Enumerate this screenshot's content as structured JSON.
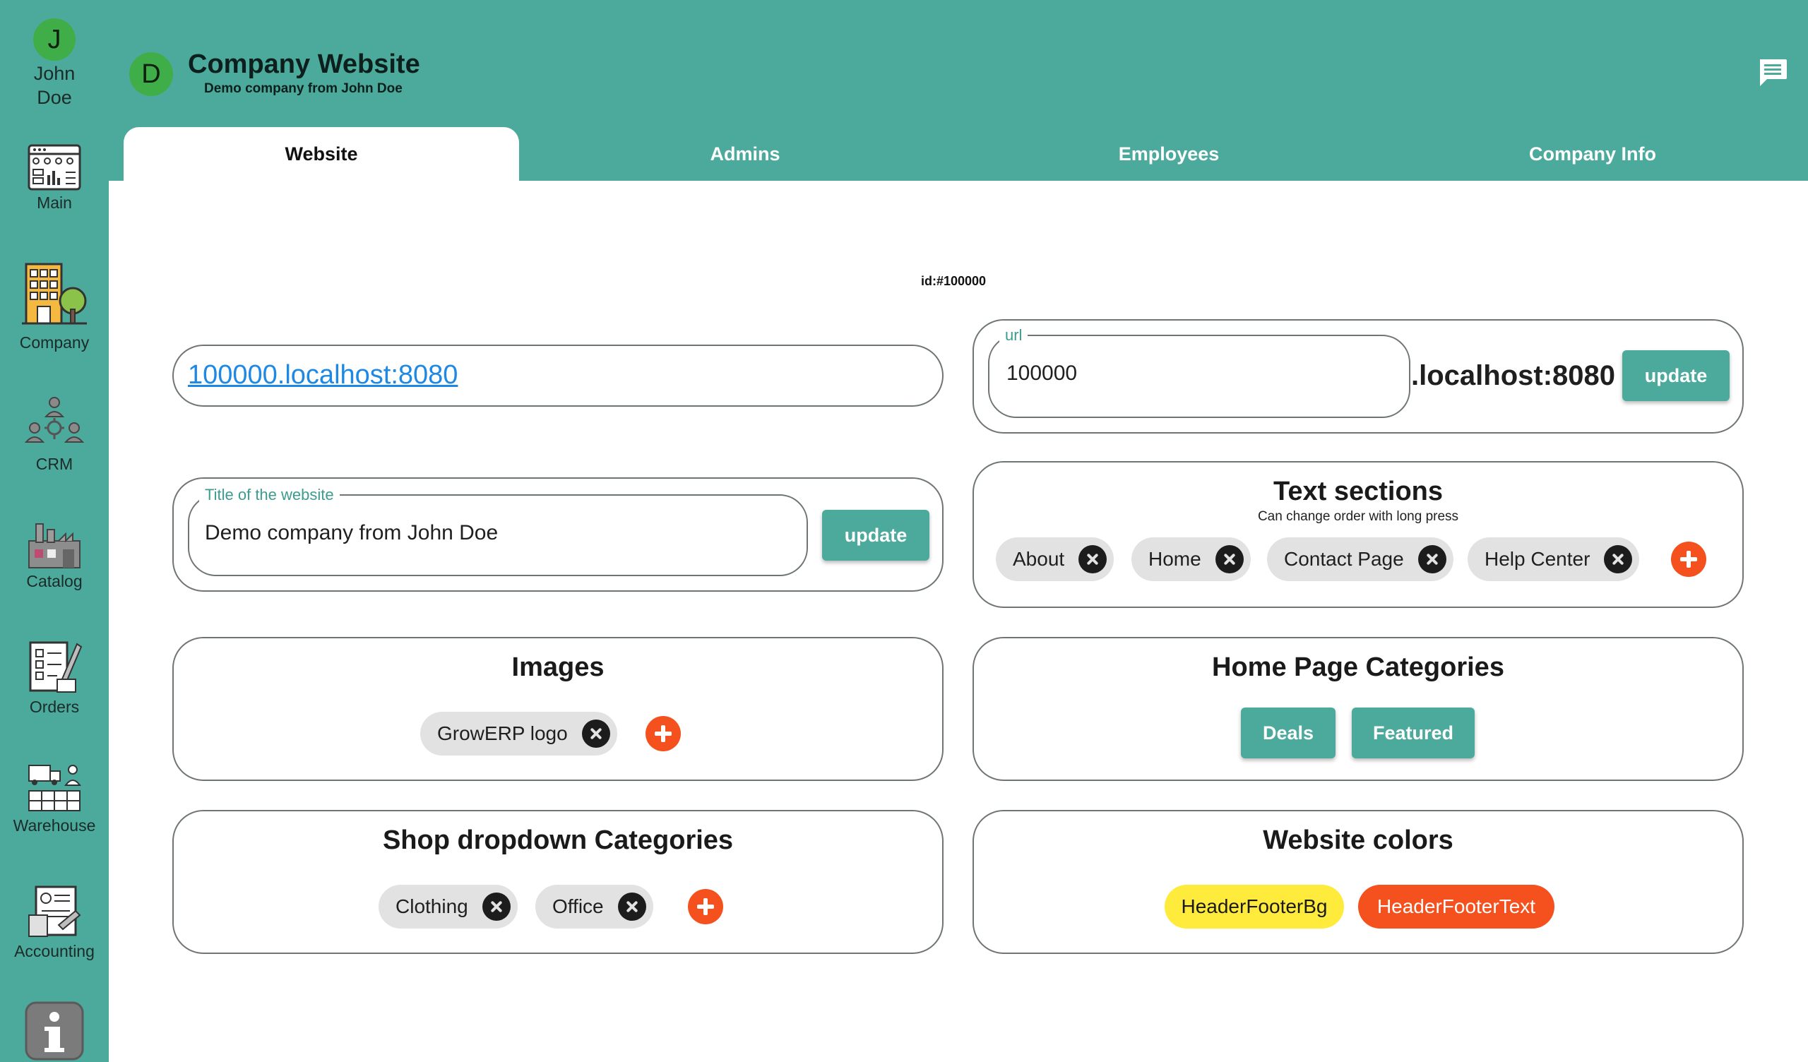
{
  "user": {
    "initial": "J",
    "first_name": "John",
    "last_name": "Doe"
  },
  "nav": [
    {
      "label": "Main",
      "icon": "dashboard-icon"
    },
    {
      "label": "Company",
      "icon": "building-icon"
    },
    {
      "label": "CRM",
      "icon": "people-network-icon"
    },
    {
      "label": "Catalog",
      "icon": "factory-icon"
    },
    {
      "label": "Orders",
      "icon": "order-form-icon"
    },
    {
      "label": "Accounting",
      "icon": "invoice-icon"
    },
    {
      "label": "Warehouse",
      "icon": "warehouse-truck-icon"
    },
    {
      "label": "",
      "icon": "info-icon"
    }
  ],
  "header": {
    "avatar_initial": "D",
    "title": "Company Website",
    "subtitle": "Demo company from John Doe",
    "chat_icon": "chat-icon"
  },
  "tabs": [
    "Website",
    "Admins",
    "Employees",
    "Company Info"
  ],
  "active_tab": "Website",
  "website": {
    "id_text": "id:#100000",
    "link": "100000.localhost:8080",
    "url_label": "url",
    "url_value": "100000",
    "url_suffix": ".localhost:8080",
    "url_update": "update",
    "title_label": "Title of the website",
    "title_value": "Demo company from John Doe",
    "title_update": "update"
  },
  "text_sections": {
    "title": "Text sections",
    "subtitle": "Can change order with long press",
    "items": [
      "About",
      "Home",
      "Contact Page",
      "Help Center"
    ]
  },
  "images": {
    "title": "Images",
    "items": [
      "GrowERP logo"
    ]
  },
  "home_categories": {
    "title": "Home Page Categories",
    "items": [
      "Deals",
      "Featured"
    ]
  },
  "shop_categories": {
    "title": "Shop dropdown Categories",
    "items": [
      "Clothing",
      "Office"
    ]
  },
  "website_colors": {
    "title": "Website colors",
    "items": [
      {
        "label": "HeaderFooterBg",
        "bg": "#ffeb3b",
        "fg": "#1a1a1a"
      },
      {
        "label": "HeaderFooterText",
        "bg": "#f4511e",
        "fg": "#ffffff"
      }
    ]
  },
  "colors": {
    "primary": "#4caa9c",
    "accent": "#f4511e",
    "avatar": "#3fae48"
  }
}
